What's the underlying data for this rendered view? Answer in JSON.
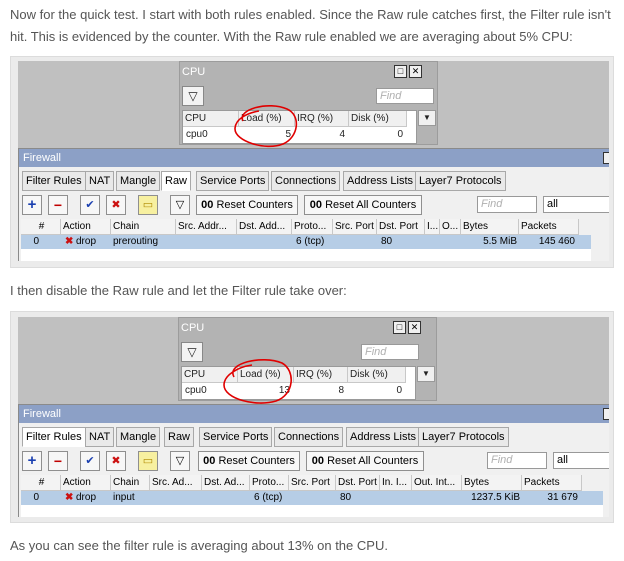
{
  "article": {
    "para1": "Now for the quick test. I start with both rules enabled. Since the Raw rule catches first, the Filter rule isn't hit. This is evidenced by the counter. With the Raw rule enabled we are averaging about 5% CPU:",
    "para2": "I then disable the Raw rule and let the Filter rule take over:",
    "para3": "As you can see the filter rule is averaging about 13% on the CPU."
  },
  "cpu_window": {
    "title": "CPU",
    "restore_icon": "□",
    "close_icon": "✕",
    "filter_icon": "▽",
    "find_placeholder": "Find",
    "columns": [
      "CPU",
      "Load (%)",
      "IRQ (%)",
      "Disk (%)"
    ],
    "dropdown_icon": "▼"
  },
  "shot1": {
    "cpu_row": {
      "cpu": "cpu0",
      "load": "5",
      "irq": "4",
      "disk": "0"
    },
    "active_tab": "Raw",
    "columns": [
      "#",
      "Action",
      "Chain",
      "Src. Addr...",
      "Dst. Add...",
      "Proto...",
      "Src. Port",
      "Dst. Port",
      "I...",
      "O...",
      "Bytes",
      "Packets"
    ],
    "row": {
      "num": "0",
      "action": "drop",
      "chain": "prerouting",
      "proto": "6 (tcp)",
      "dst_port": "80",
      "bytes": "5.5 MiB",
      "packets": "145 460"
    }
  },
  "shot2": {
    "cpu_row": {
      "cpu": "cpu0",
      "load": "13",
      "irq": "8",
      "disk": "0"
    },
    "active_tab": "Filter Rules",
    "columns": [
      "#",
      "Action",
      "Chain",
      "Src. Ad...",
      "Dst. Ad...",
      "Proto...",
      "Src. Port",
      "Dst. Port",
      "In. I...",
      "Out. Int...",
      "Bytes",
      "Packets"
    ],
    "row": {
      "num": "0",
      "action": "drop",
      "chain": "input",
      "proto": "6 (tcp)",
      "dst_port": "80",
      "bytes": "1237.5 KiB",
      "packets": "31 679"
    }
  },
  "firewall": {
    "title": "Firewall",
    "tabs": [
      "Filter Rules",
      "NAT",
      "Mangle",
      "Raw",
      "Service Ports",
      "Connections",
      "Address Lists",
      "Layer7 Protocols"
    ],
    "toolbar": {
      "add_icon": "+",
      "remove_icon": "−",
      "enable_icon": "✔",
      "disable_icon": "✖",
      "comment_icon": "▭",
      "filter_icon": "▽",
      "reset_counters": "Reset Counters",
      "reset_all_counters": "Reset All Counters",
      "reset_prefix": "00",
      "find_placeholder": "Find",
      "scope_value": "all"
    },
    "drop_icon": "✖"
  },
  "colors": {
    "paragraph_text": "#555555",
    "title_bar": "#8ca0c6",
    "selected_row": "#b6cde6",
    "annotation_red": "#e00000",
    "drop_icon": "#cc1111",
    "add_icon": "#1a3fb0"
  }
}
